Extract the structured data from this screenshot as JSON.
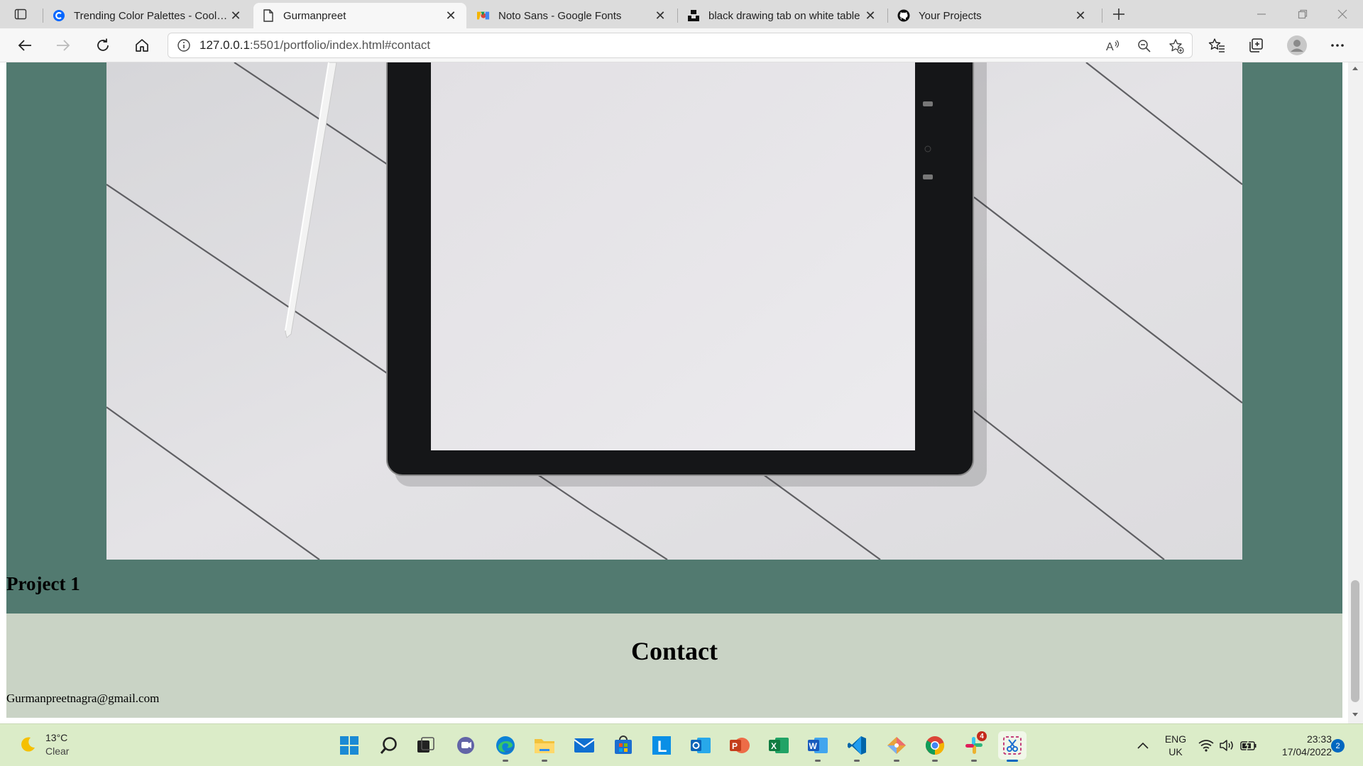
{
  "browser": {
    "tabs": [
      {
        "title": "Trending Color Palettes - Coolors",
        "icon": "coolors-icon",
        "active": false
      },
      {
        "title": "Gurmanpreet",
        "icon": "page-icon",
        "active": true
      },
      {
        "title": "Noto Sans - Google Fonts",
        "icon": "google-fonts-icon",
        "active": false
      },
      {
        "title": "black drawing tab on white table",
        "icon": "unsplash-icon",
        "active": false
      },
      {
        "title": "Your Projects",
        "icon": "github-icon",
        "active": false
      }
    ],
    "address": {
      "host": "127.0.0.1",
      "path": ":5501/portfolio/index.html#contact"
    }
  },
  "page": {
    "hero_image_alt": "black drawing tab on white table",
    "project_title": "Project 1",
    "contact_heading": "Contact",
    "contact_email": "Gurmanpreetnagra@gmail.com",
    "colors": {
      "project_bg": "#527a70",
      "contact_bg": "#c9d3c5"
    }
  },
  "taskbar": {
    "weather": {
      "temp": "13°C",
      "condition": "Clear"
    },
    "apps": [
      "windows-start",
      "search",
      "task-view",
      "teams-chat",
      "edge",
      "file-explorer",
      "mail",
      "store",
      "l-app",
      "outlook",
      "powerpoint",
      "excel",
      "word",
      "vscode",
      "git-app",
      "chrome",
      "slack",
      "snipping-tool"
    ],
    "slack_badge": "4",
    "language": {
      "line1": "ENG",
      "line2": "UK"
    },
    "clock": {
      "time": "23:33",
      "date": "17/04/2022"
    },
    "notifications": "2"
  }
}
